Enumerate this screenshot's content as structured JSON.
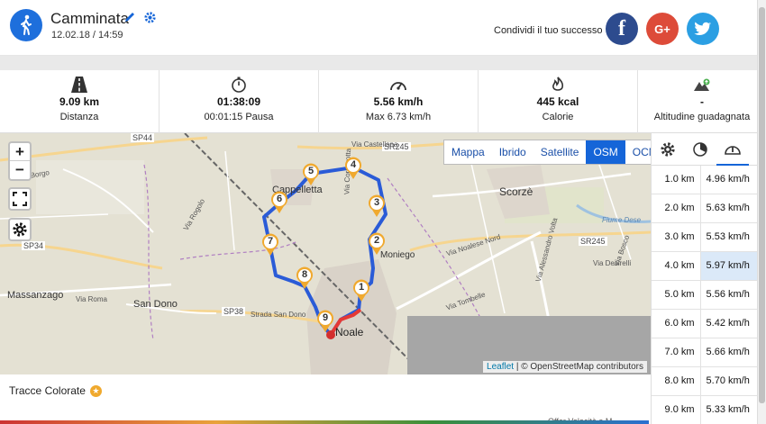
{
  "header": {
    "title": "Camminata",
    "date": "12.02.18 / 14:59",
    "share_text": "Condividi il tuo successo",
    "social": {
      "facebook": "f",
      "google": "G+",
      "twitter": "t"
    }
  },
  "stats": [
    {
      "icon": "road-icon",
      "value": "9.09 km",
      "label": "Distanza"
    },
    {
      "icon": "stopwatch-icon",
      "value": "01:38:09",
      "label": "00:01:15 Pausa"
    },
    {
      "icon": "speedometer-icon",
      "value": "5.56 km/h",
      "label": "Max 6.73 km/h"
    },
    {
      "icon": "flame-icon",
      "value": "445 kcal",
      "label": "Calorie"
    },
    {
      "icon": "mountain-icon",
      "value": "-",
      "label": "Altitudine guadagnata"
    }
  ],
  "map": {
    "layers": [
      "Mappa",
      "Ibrido",
      "Satellite",
      "OSM",
      "OCM"
    ],
    "active_layer": "OSM",
    "zoom_in": "+",
    "zoom_out": "−",
    "attribution_leaflet": "Leaflet",
    "attribution_osm": "© OpenStreetMap contributors",
    "places": [
      {
        "name": "SP44"
      },
      {
        "name": "SR245"
      },
      {
        "name": "Via Castellana"
      },
      {
        "name": "Cappelletta"
      },
      {
        "name": "Scorzè"
      },
      {
        "name": "Moniego"
      },
      {
        "name": "SP34"
      },
      {
        "name": "Massanzago"
      },
      {
        "name": "San Dono"
      },
      {
        "name": "SP38"
      },
      {
        "name": "Noale"
      },
      {
        "name": "SR245"
      },
      {
        "name": "Via Noalese Nord"
      },
      {
        "name": "Fiume Dese"
      },
      {
        "name": "Via Roma"
      },
      {
        "name": "Via Borgo"
      },
      {
        "name": "Strada San Dono"
      },
      {
        "name": "Via Rogolo"
      },
      {
        "name": "Via Cornarotta"
      },
      {
        "name": "Via Tombelle"
      },
      {
        "name": "Via Alessandro Volta"
      },
      {
        "name": "Via Desirelli"
      },
      {
        "name": "Via Bosco"
      }
    ],
    "markers": [
      "1",
      "2",
      "3",
      "4",
      "5",
      "6",
      "7",
      "8",
      "9"
    ]
  },
  "footer": {
    "tracce": "Tracce Colorate",
    "star": "★",
    "offer": "Offer Velocità a M"
  },
  "splits": {
    "rows": [
      {
        "km": "1.0 km",
        "speed": "4.96 km/h",
        "highlight": false
      },
      {
        "km": "2.0 km",
        "speed": "5.63 km/h",
        "highlight": false
      },
      {
        "km": "3.0 km",
        "speed": "5.53 km/h",
        "highlight": false
      },
      {
        "km": "4.0 km",
        "speed": "5.97 km/h",
        "highlight": true
      },
      {
        "km": "5.0 km",
        "speed": "5.56 km/h",
        "highlight": false
      },
      {
        "km": "6.0 km",
        "speed": "5.42 km/h",
        "highlight": false
      },
      {
        "km": "7.0 km",
        "speed": "5.66 km/h",
        "highlight": false
      },
      {
        "km": "8.0 km",
        "speed": "5.70 km/h",
        "highlight": false
      },
      {
        "km": "9.0 km",
        "speed": "5.33 km/h",
        "highlight": false
      }
    ]
  },
  "colors": {
    "accent": "#1565d8",
    "route": "#2a5bd7",
    "route_start": "#e53935",
    "marker": "#f0a92e"
  }
}
